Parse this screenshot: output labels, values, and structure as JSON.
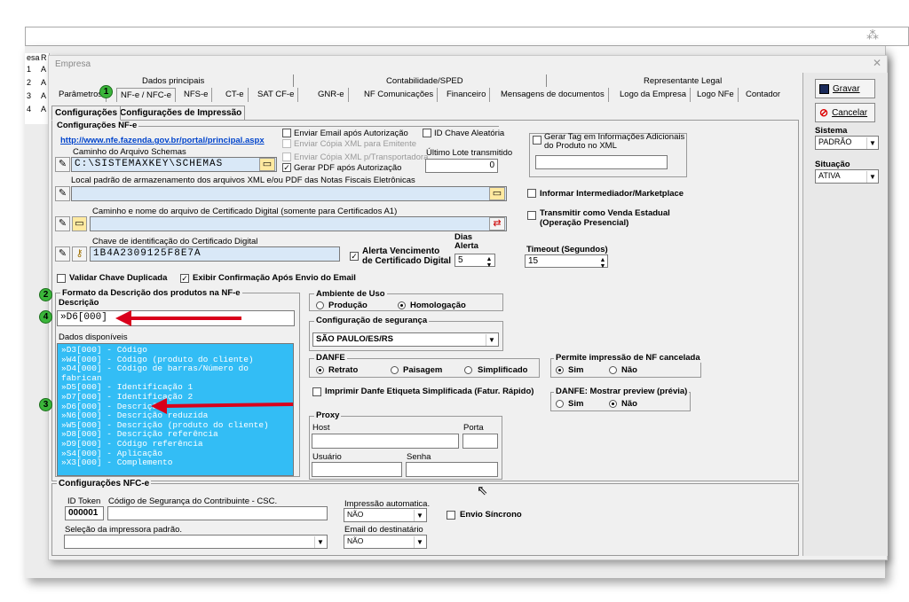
{
  "bg": {
    "col_header": "esa",
    "col_r": "R",
    "rows": [
      "1",
      "2",
      "3",
      "4"
    ],
    "cells": [
      "A",
      "A",
      "A",
      "A"
    ]
  },
  "window": {
    "title": "Empresa",
    "close": "✕"
  },
  "groups": [
    "Dados principais",
    "Contabilidade/SPED",
    "Representante Legal"
  ],
  "tabs": [
    "Parâmetros",
    "NF-e / NFC-e",
    "NFS-e",
    "CT-e",
    "SAT CF-e",
    "GNR-e",
    "NF Comunicações",
    "Financeiro",
    "Mensagens de documentos",
    "Logo da Empresa",
    "Logo NFe",
    "Contador"
  ],
  "subtabs": [
    "Configurações",
    "Configurações de Impressão"
  ],
  "right": {
    "gravar": "Gravar",
    "cancelar": "Cancelar",
    "sistema_label": "Sistema",
    "sistema_value": "PADRÃO",
    "situacao_label": "Situação",
    "situacao_value": "ATIVA"
  },
  "nfe": {
    "legend": "Configurações NF-e",
    "portal": "http://www.nfe.fazenda.gov.br/portal/principal.aspx",
    "schemas_label": "Caminho do Arquivo Schemas",
    "schemas_value": "C:\\SISTEMAXKEY\\SCHEMAS",
    "xml_label": "Local padrão de armazenamento dos arquivos XML e/ou PDF das Notas Fiscais Eletrônicas",
    "cert_label": "Caminho e nome do arquivo de Certificado Digital (somente para Certificados A1)",
    "chave_label": "Chave de identificação do Certificado Digital",
    "chave_value": "1B4A2309125F8E7A",
    "enviar_email": "Enviar Email após Autorização",
    "copia_emitente": "Enviar Cópia XML para Emitente",
    "copia_transp": "Enviar Cópia XML p/Transportadora",
    "gerar_pdf": "Gerar PDF após Autorização",
    "id_chave": "ID Chave Aleatória",
    "ultimo_lote_label": "Último Lote transmitido",
    "ultimo_lote_value": "0",
    "gerar_tag": "Gerar Tag em Informações Adicionais do Produto no XML",
    "intermediador": "Informar Intermediador/Marketplace",
    "transmitir": "Transmitir como Venda Estadual (Operação Presencial)",
    "alerta": "Alerta Vencimento de Certificado Digital",
    "dias_label": "Dias Alerta",
    "dias_value": "5",
    "timeout_label": "Timeout (Segundos)",
    "timeout_value": "15",
    "validar": "Validar Chave Duplicada",
    "exibir": "Exibir Confirmação Após Envio do Email"
  },
  "formato": {
    "legend": "Formato da Descrição dos produtos na NF-e",
    "desc_label": "Descrição",
    "desc_value": "»D6[000]",
    "dados_label": "Dados disponíveis",
    "items": [
      "»D3[000] - Código",
      "»W4[000] - Código (produto do cliente)",
      "»D4[000] - Código de barras/Número do fabrican",
      "»D5[000] - Identificação 1",
      "»D7[000] - Identificação 2",
      "»D6[000] - Descrição",
      "»N6[000] - Descrição reduzida",
      "»W5[000] - Descrição (produto do cliente)",
      "»D8[000] - Descrição referência",
      "»D9[000] - Código referência",
      "»S4[000] - Aplicação",
      "»X3[000] - Complemento"
    ]
  },
  "ambiente": {
    "legend": "Ambiente de Uso",
    "producao": "Produção",
    "homologacao": "Homologação"
  },
  "seguranca": {
    "legend": "Configuração de segurança",
    "value": "SÃO PAULO/ES/RS"
  },
  "danfe": {
    "legend": "DANFE",
    "retrato": "Retrato",
    "paisagem": "Paisagem",
    "simplificado": "Simplificado"
  },
  "etiqueta": "Imprimir Danfe Etiqueta Simplificada (Fatur. Rápido)",
  "cancelada": {
    "legend": "Permite impressão de NF cancelada",
    "sim": "Sim",
    "nao": "Não"
  },
  "preview": {
    "legend": "DANFE: Mostrar preview (prévia)",
    "sim": "Sim",
    "nao": "Não"
  },
  "proxy": {
    "legend": "Proxy",
    "host": "Host",
    "porta": "Porta",
    "usuario": "Usuário",
    "senha": "Senha"
  },
  "nfce": {
    "legend": "Configurações NFC-e",
    "id_token": "ID Token",
    "id_value": "000001",
    "csc_label": "Código de Segurança do Contribuinte - CSC.",
    "impressao_label": "Impressão automatica.",
    "impressao_value": "NÃO",
    "sincrono": "Envio Síncrono",
    "impressora_label": "Seleção da impressora padrão.",
    "email_label": "Email do destinatário",
    "email_value": "NÃO"
  },
  "badges": [
    "1",
    "2",
    "3",
    "4"
  ],
  "colors": {
    "list_bg": "#33bdf5",
    "arrow": "#d9001b",
    "badge": "#3ab53a"
  }
}
